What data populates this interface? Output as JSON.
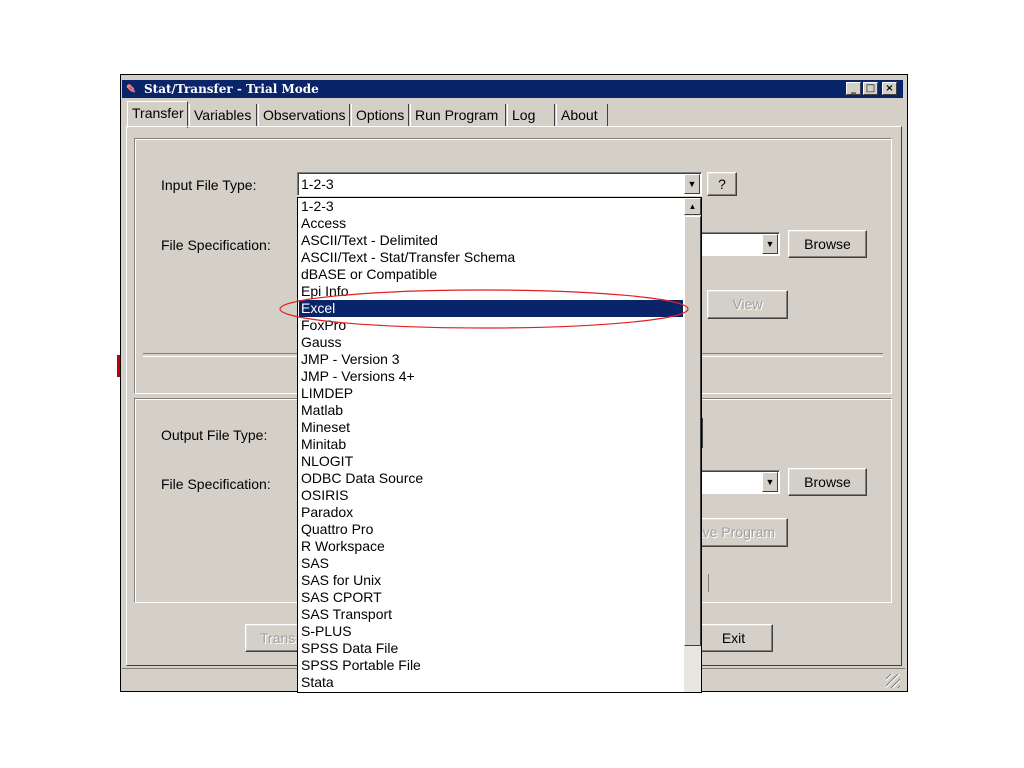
{
  "window": {
    "title": "Stat/Transfer - Trial Mode"
  },
  "tabs": [
    {
      "label": "Transfer"
    },
    {
      "label": "Variables"
    },
    {
      "label": "Observations"
    },
    {
      "label": "Options"
    },
    {
      "label": "Run Program"
    },
    {
      "label": "Log"
    },
    {
      "label": "About"
    }
  ],
  "input": {
    "file_type_label": "Input File Type:",
    "file_type_value": "1-2-3",
    "help_label": "?",
    "file_spec_label": "File Specification:",
    "browse_label": "Browse",
    "view_label": "View"
  },
  "output": {
    "file_type_label": "Output File Type:",
    "file_spec_label": "File Specification:",
    "browse_label": "Browse",
    "save_program_partial": "ave Program"
  },
  "footer": {
    "transfer_partial": "Trans",
    "exit_label": "Exit"
  },
  "dropdown": {
    "selected": "Excel",
    "items": [
      "1-2-3",
      "Access",
      "ASCII/Text - Delimited",
      "ASCII/Text - Stat/Transfer Schema",
      "dBASE or Compatible",
      "Epi Info",
      "Excel",
      "FoxPro",
      "Gauss",
      "JMP - Version 3",
      "JMP - Versions 4+",
      "LIMDEP",
      "Matlab",
      "Mineset",
      "Minitab",
      "NLOGIT",
      "ODBC Data Source",
      "OSIRIS",
      "Paradox",
      "Quattro Pro",
      "R Workspace",
      "SAS",
      "SAS for Unix",
      "SAS CPORT",
      "SAS Transport",
      "S-PLUS",
      "SPSS Data File",
      "SPSS Portable File",
      "Stata"
    ]
  },
  "colors": {
    "titlebar": "#0a246a",
    "selection": "#0a246a",
    "highlight_ellipse": "#e02020",
    "face": "#d4d0c8"
  }
}
